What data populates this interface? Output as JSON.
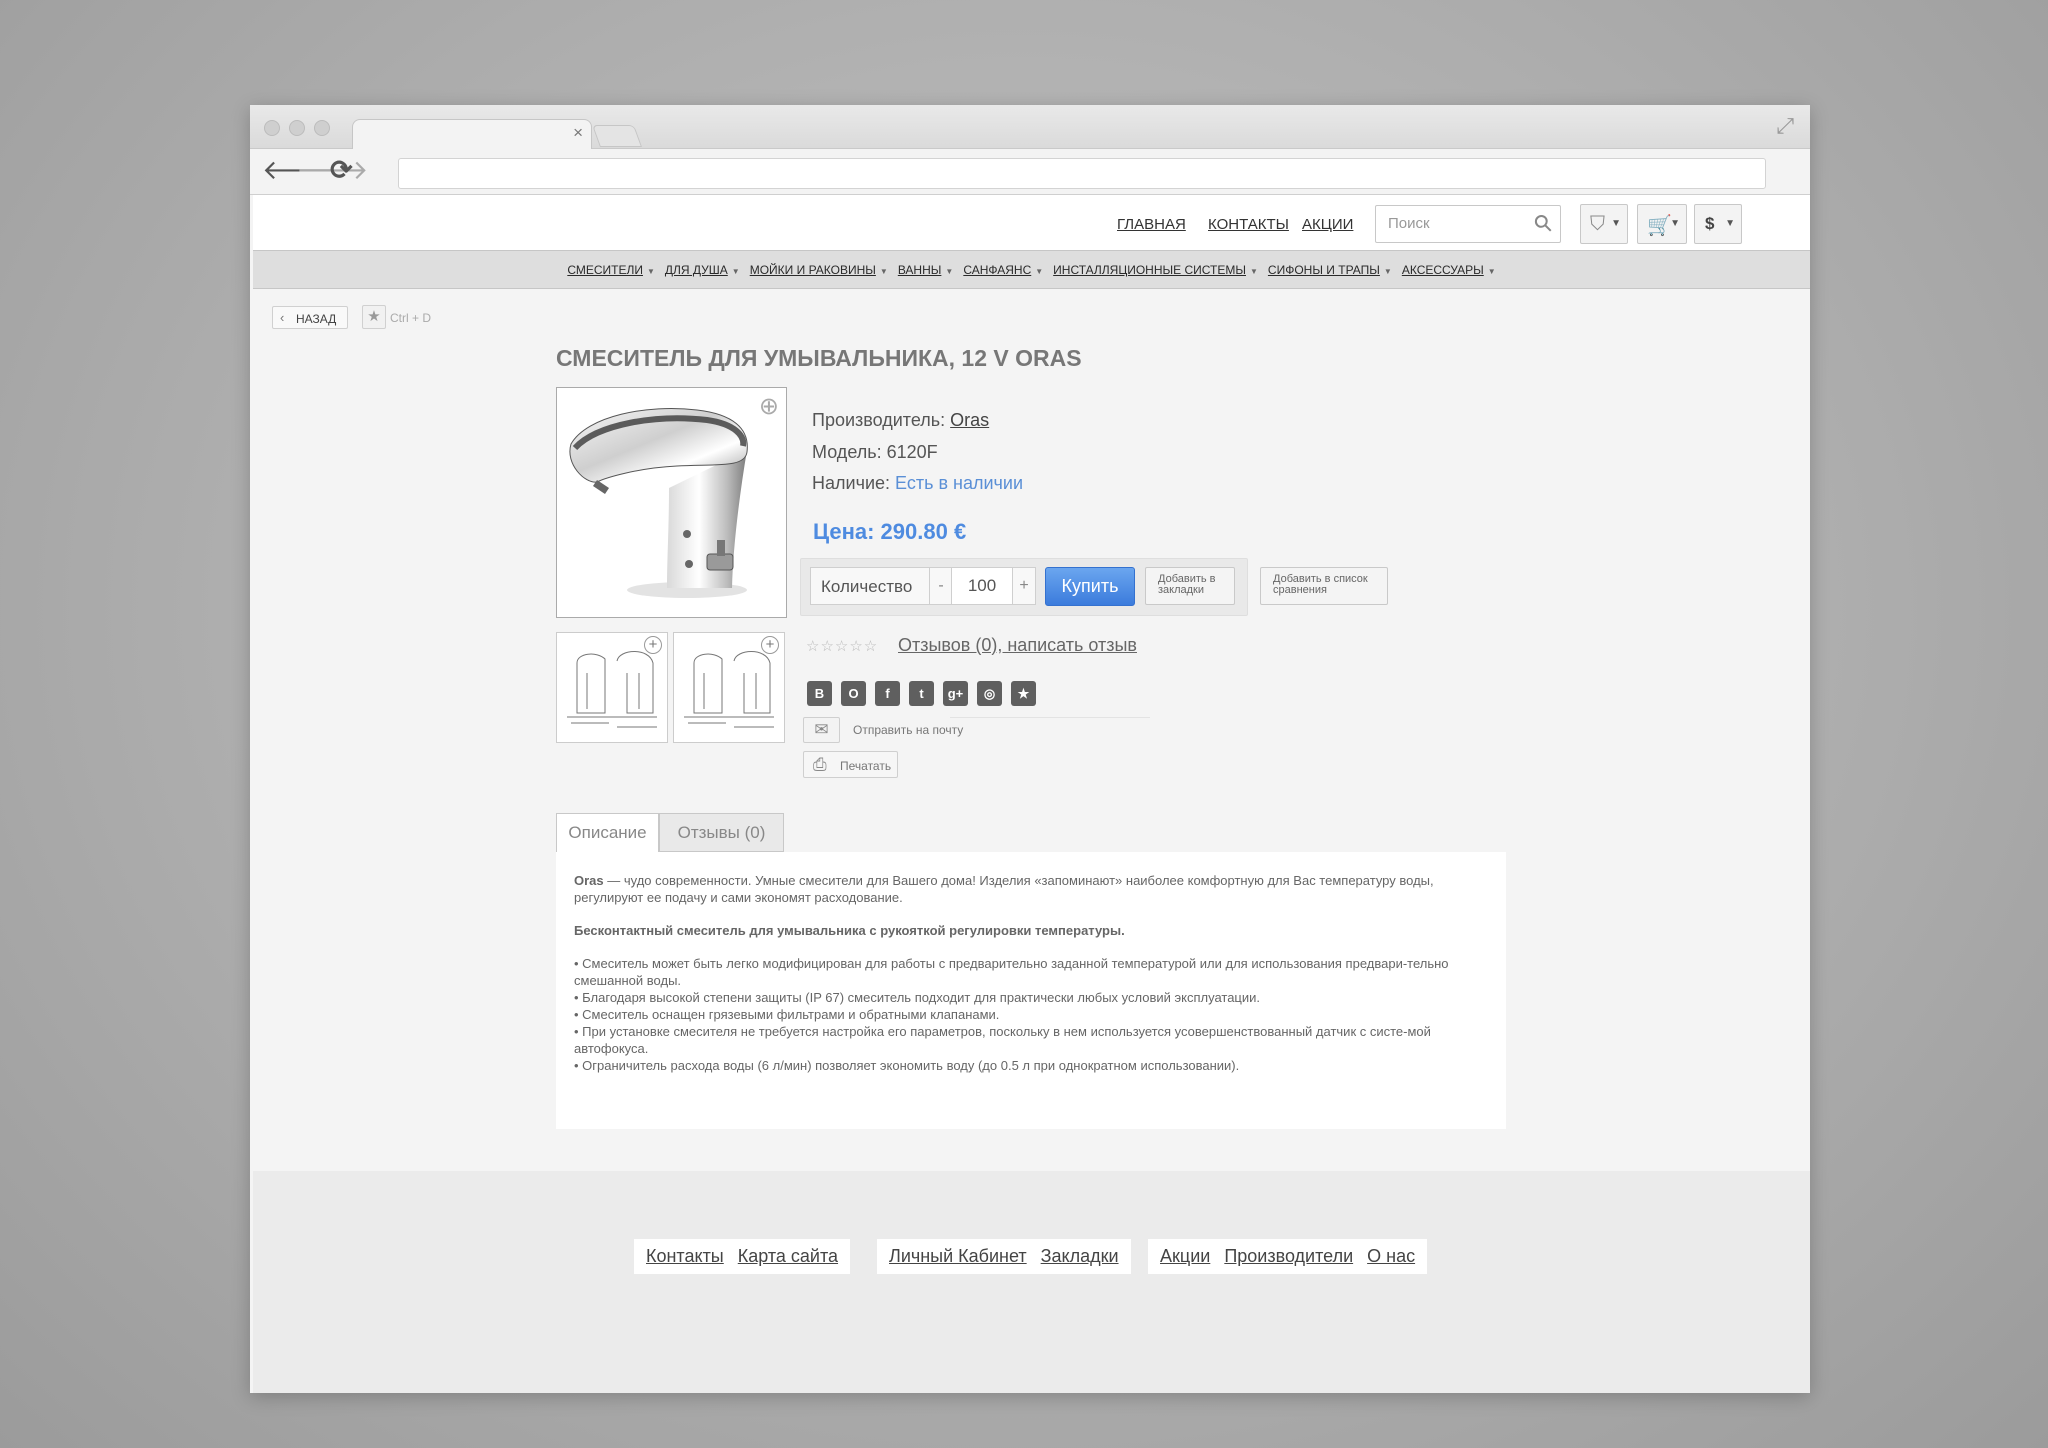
{
  "browser": {
    "tab_close": "×",
    "expand_icon": "arrows-expand",
    "nav": {
      "back": "🡐",
      "forward": "🡒",
      "reload": "⟳"
    }
  },
  "header": {
    "links": [
      "ГЛАВНАЯ",
      "КОНТАКТЫ",
      "АКЦИИ"
    ],
    "search_placeholder": "Поиск",
    "currency": "$"
  },
  "categories": [
    "СМЕСИТЕЛИ",
    "ДЛЯ ДУША",
    "МОЙКИ И РАКОВИНЫ",
    "ВАННЫ",
    "САНФАЯНС",
    "ИНСТАЛЛЯЦИОННЫЕ СИСТЕМЫ",
    "СИФОНЫ И ТРАПЫ",
    "АКСЕССУАРЫ"
  ],
  "back_label": "НАЗАД",
  "bookmark_hotkey": "Ctrl + D",
  "product": {
    "title": "СМЕСИТЕЛЬ ДЛЯ УМЫВАЛЬНИКА, 12 V ORAS",
    "manufacturer_label": "Производитель:",
    "manufacturer": "Oras",
    "model_label": "Модель:",
    "model": "6120F",
    "availability_label": "Наличие:",
    "availability": "Есть в наличии",
    "price": "Цена: 290.80 €",
    "qty_label": "Количество",
    "qty_minus": "-",
    "qty_plus": "+",
    "qty_value": "100",
    "buy_label": "Купить",
    "bookmark_label": "Добавить в закладки",
    "compare_label": "Добавить в список сравнения",
    "reviews_link": "Отзывов (0), написать отзыв",
    "rating": 0,
    "share_email": "Отправить на почту",
    "print": "Печатать",
    "social_icons": [
      "vk-icon",
      "odnoklassniki-icon",
      "facebook-icon",
      "twitter-icon",
      "googleplus-icon",
      "instagram-icon",
      "favorite-star-icon"
    ]
  },
  "tabs": {
    "description": "Описание",
    "reviews": "Отзывы (0)"
  },
  "description": {
    "brand": "Oras",
    "intro": " — чудо современности. Умные смесители для Вашего дома! Изделия «запоминают» наиболее комфортную для Вас температуру воды, регулируют ее подачу и сами экономят расходование.",
    "headline": "Бесконтактный смеситель для умывальника с рукояткой регулировки температуры.",
    "bullets": [
      "• Смеситель может быть легко модифицирован для работы с предварительно заданной температурой или для использования предвари-тельно смешанной воды.",
      "• Благодаря высокой степени защиты (IP 67) смеситель подходит для практически любых условий эксплуатации.",
      "• Смеситель оснащен грязевыми фильтрами и обратными клапанами.",
      "• При установке смесителя не требуется настройка его параметров, поскольку в нем используется усовершенствованный датчик с систе-мой автофокуса.",
      "• Ограничитель расхода воды (6 л/мин) позволяет экономить воду (до 0.5 л при однократном использовании)."
    ]
  },
  "footer": {
    "group1": [
      "Контакты",
      "Карта сайта"
    ],
    "group2": [
      "Личный Кабинет",
      "Закладки"
    ],
    "group3": [
      "Акции",
      "Производители",
      "О нас"
    ]
  }
}
